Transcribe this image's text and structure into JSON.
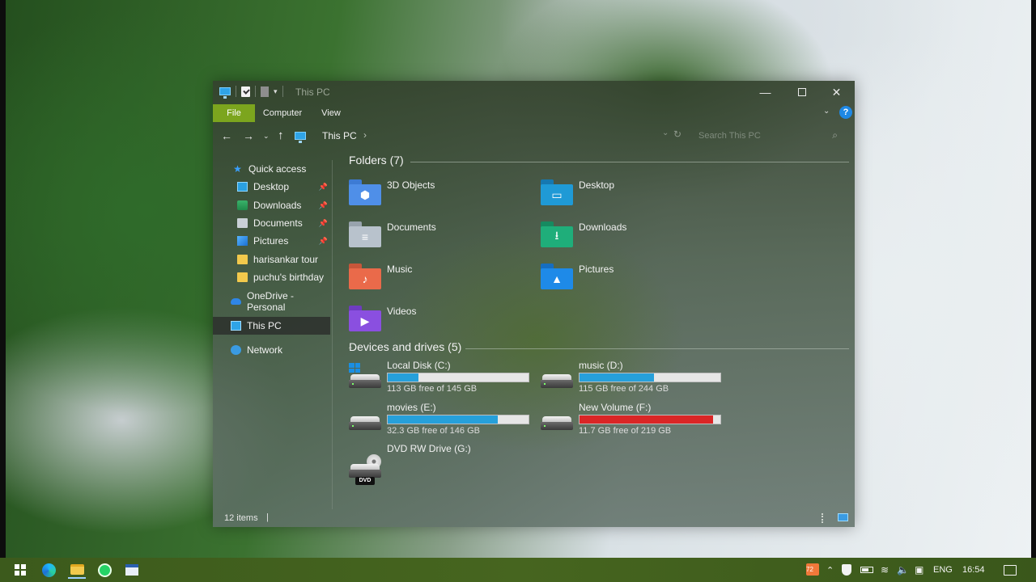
{
  "window": {
    "title": "This PC",
    "controls": {
      "minimize": "—",
      "maximize": "",
      "close": "✕"
    }
  },
  "ribbon": {
    "tabs": [
      "File",
      "Computer",
      "View"
    ],
    "help_label": "?"
  },
  "address": {
    "back": "←",
    "forward": "→",
    "recent": "⌄",
    "up": "↑",
    "crumb": "This PC",
    "crumb_arrow": "›",
    "search_placeholder": "Search This PC"
  },
  "nav_pane": {
    "quick_access": "Quick access",
    "items": [
      {
        "label": "Desktop",
        "icon": "desktop-icon",
        "pinned": true
      },
      {
        "label": "Downloads",
        "icon": "downloads-icon",
        "pinned": true
      },
      {
        "label": "Documents",
        "icon": "documents-icon",
        "pinned": true
      },
      {
        "label": "Pictures",
        "icon": "pictures-icon",
        "pinned": true
      },
      {
        "label": "harisankar tour",
        "icon": "folder-icon",
        "pinned": false
      },
      {
        "label": "puchu's birthday",
        "icon": "folder-icon",
        "pinned": false
      }
    ],
    "onedrive": "OneDrive - Personal",
    "this_pc": "This PC",
    "network": "Network"
  },
  "folders": {
    "heading": "Folders (7)",
    "items": [
      {
        "label": "3D Objects",
        "icon": "3d-objects-icon",
        "color": "#4f8fe8",
        "glyph": "⬢"
      },
      {
        "label": "Desktop",
        "icon": "desktop-folder-icon",
        "color": "#1f9ad6",
        "glyph": "▭"
      },
      {
        "label": "Documents",
        "icon": "documents-folder-icon",
        "color": "#b8c2cc",
        "glyph": "≡"
      },
      {
        "label": "Downloads",
        "icon": "downloads-folder-icon",
        "color": "#1fae7a",
        "glyph": "⭳"
      },
      {
        "label": "Music",
        "icon": "music-folder-icon",
        "color": "#ea6a4a",
        "glyph": "♪"
      },
      {
        "label": "Pictures",
        "icon": "pictures-folder-icon",
        "color": "#1e8ae8",
        "glyph": "▲"
      },
      {
        "label": "Videos",
        "icon": "videos-folder-icon",
        "color": "#8a4fe0",
        "glyph": "▶"
      }
    ]
  },
  "drives": {
    "heading": "Devices and drives (5)",
    "items": [
      {
        "name": "Local Disk (C:)",
        "free": "113 GB free of 145 GB",
        "used_fraction": 0.22,
        "status": "normal",
        "system": true
      },
      {
        "name": "music (D:)",
        "free": "115 GB free of 244 GB",
        "used_fraction": 0.53,
        "status": "normal",
        "system": false
      },
      {
        "name": "movies (E:)",
        "free": "32.3 GB free of 146 GB",
        "used_fraction": 0.78,
        "status": "normal",
        "system": false
      },
      {
        "name": "New Volume (F:)",
        "free": "11.7 GB free of 219 GB",
        "used_fraction": 0.95,
        "status": "full",
        "system": false
      },
      {
        "name": "DVD RW Drive (G:)",
        "badge": "DVD"
      }
    ]
  },
  "status_bar": {
    "items": "12 items",
    "separator": "|"
  },
  "taskbar": {
    "apps": [
      "start-icon",
      "edge-icon",
      "file-explorer-icon",
      "whatsapp-icon",
      "app-icon"
    ],
    "tray": {
      "badge": "72",
      "chevron": "⌃",
      "wifi": "≋",
      "volume": "🔈",
      "mic": "▣",
      "language": "ENG",
      "clock": "16:54"
    }
  },
  "colors": {
    "accent_file_tab": "#7ca51e",
    "drive_bar": "#26a0da",
    "drive_bar_full": "#da2626",
    "taskbar": "#46651f"
  }
}
